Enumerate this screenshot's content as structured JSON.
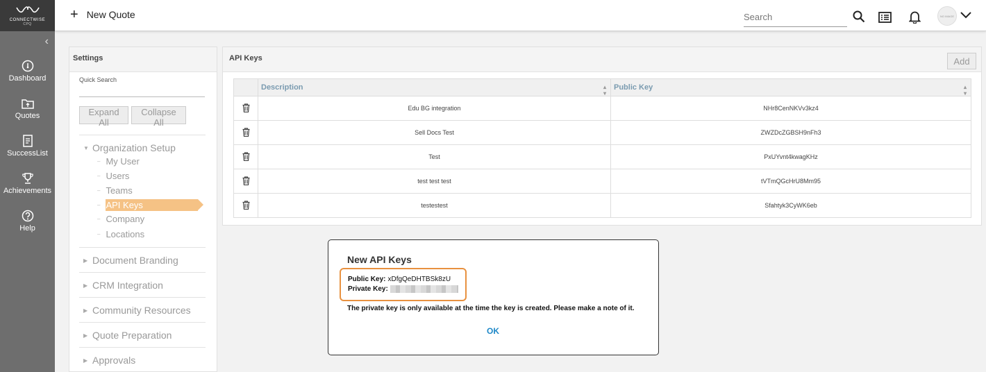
{
  "app": {
    "brand": "CONNECTWISE",
    "brand_sub": "CPQ"
  },
  "leftnav": {
    "items": [
      {
        "label": "Dashboard",
        "icon": "dashboard-icon"
      },
      {
        "label": "Quotes",
        "icon": "quotes-icon"
      },
      {
        "label": "SuccessList",
        "icon": "successlist-icon"
      },
      {
        "label": "Achievements",
        "icon": "trophy-icon"
      },
      {
        "label": "Help",
        "icon": "help-icon"
      }
    ]
  },
  "topbar": {
    "new_quote_label": "New Quote",
    "search_placeholder": "Search",
    "avatar_text": "NO IMAGE"
  },
  "settings": {
    "title": "Settings",
    "quick_search_label": "Quick Search",
    "expand_all": "Expand All",
    "collapse_all": "Collapse All",
    "tree": {
      "org_setup": "Organization Setup",
      "children": [
        "My User",
        "Users",
        "Teams",
        "API Keys",
        "Company",
        "Locations"
      ],
      "active_child": "API Keys",
      "document_branding": "Document Branding",
      "crm_integration": "CRM Integration",
      "community_resources": "Community Resources",
      "quote_preparation": "Quote Preparation",
      "approvals": "Approvals"
    }
  },
  "api_keys": {
    "title": "API Keys",
    "add_label": "Add",
    "columns": [
      "Description",
      "Public Key"
    ],
    "rows": [
      {
        "description": "Edu BG integration",
        "public_key": "NHr8CenNKVv3kz4"
      },
      {
        "description": "Sell Docs Test",
        "public_key": "ZWZDcZGBSH9nFh3"
      },
      {
        "description": "Test",
        "public_key": "PxUYvnt4kwagKHz"
      },
      {
        "description": "test test test",
        "public_key": "tVTmQGcHrU8Mm95"
      },
      {
        "description": "testestest",
        "public_key": "Sfahtyk3CyWK6eb"
      }
    ]
  },
  "modal": {
    "title": "New API Keys",
    "public_key_label": "Public Key:",
    "public_key_value": "xDfgQeDHTBSk8zU",
    "private_key_label": "Private Key:",
    "note": "The private key is only available at the time the key is created. Please make a note of it.",
    "ok_label": "OK",
    "highlight_color": "#e8913f"
  },
  "colors": {
    "sidebar": "#6e6e6e",
    "active_item": "#f5c285",
    "link": "#1e88c8"
  }
}
